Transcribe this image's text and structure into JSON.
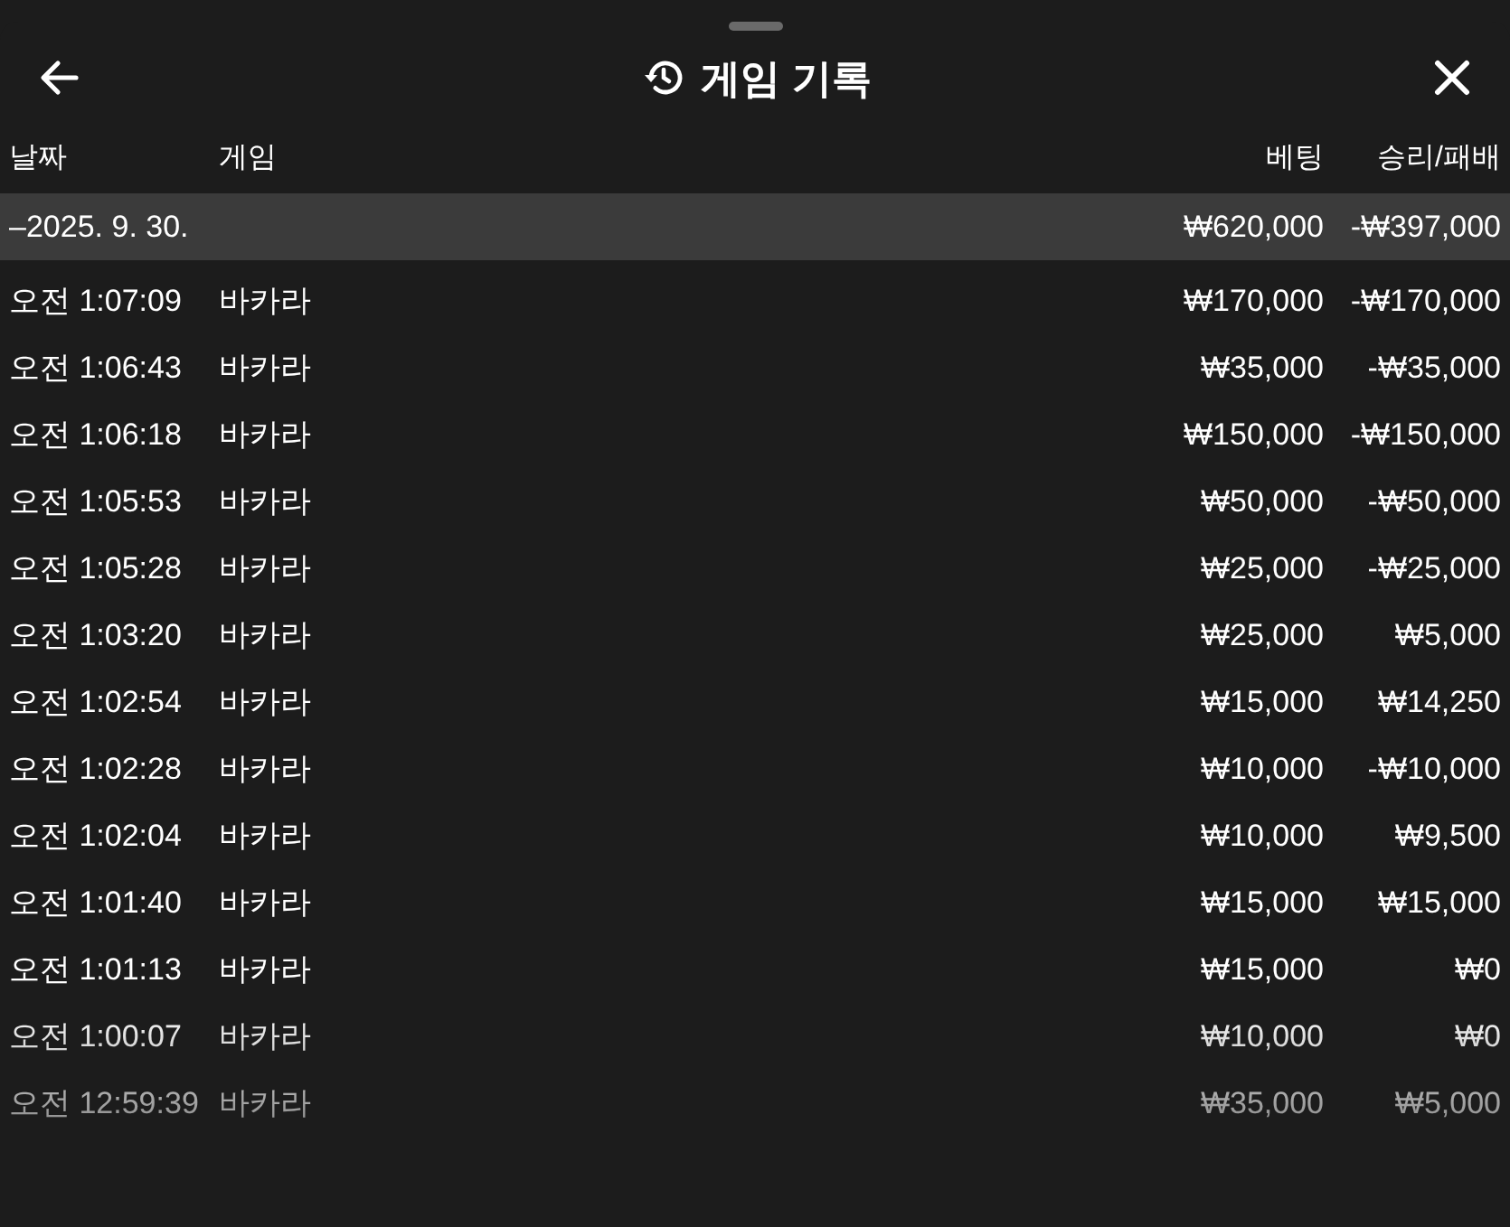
{
  "header": {
    "title": "게임 기록"
  },
  "table": {
    "columns": [
      "날짜",
      "게임",
      "베팅",
      "승리/패배"
    ],
    "groups": [
      {
        "toggle": "–",
        "date": "2025. 9. 30.",
        "expanded": true,
        "bet": "₩620,000",
        "result": "-₩397,000",
        "rows": [
          {
            "time": "오전 1:07:09",
            "game": "바카라",
            "bet": "₩170,000",
            "result": "-₩170,000"
          },
          {
            "time": "오전 1:06:43",
            "game": "바카라",
            "bet": "₩35,000",
            "result": "-₩35,000"
          },
          {
            "time": "오전 1:06:18",
            "game": "바카라",
            "bet": "₩150,000",
            "result": "-₩150,000"
          },
          {
            "time": "오전 1:05:53",
            "game": "바카라",
            "bet": "₩50,000",
            "result": "-₩50,000"
          },
          {
            "time": "오전 1:05:28",
            "game": "바카라",
            "bet": "₩25,000",
            "result": "-₩25,000"
          },
          {
            "time": "오전 1:03:20",
            "game": "바카라",
            "bet": "₩25,000",
            "result": "₩5,000"
          },
          {
            "time": "오전 1:02:54",
            "game": "바카라",
            "bet": "₩15,000",
            "result": "₩14,250"
          },
          {
            "time": "오전 1:02:28",
            "game": "바카라",
            "bet": "₩10,000",
            "result": "-₩10,000"
          },
          {
            "time": "오전 1:02:04",
            "game": "바카라",
            "bet": "₩10,000",
            "result": "₩9,500"
          },
          {
            "time": "오전 1:01:40",
            "game": "바카라",
            "bet": "₩15,000",
            "result": "₩15,000"
          },
          {
            "time": "오전 1:01:13",
            "game": "바카라",
            "bet": "₩15,000",
            "result": "₩0"
          },
          {
            "time": "오전 1:00:07",
            "game": "바카라",
            "bet": "₩10,000",
            "result": "₩0"
          },
          {
            "time": "오전 12:59:39",
            "game": "바카라",
            "bet": "₩35,000",
            "result": "₩5,000"
          }
        ]
      }
    ]
  }
}
